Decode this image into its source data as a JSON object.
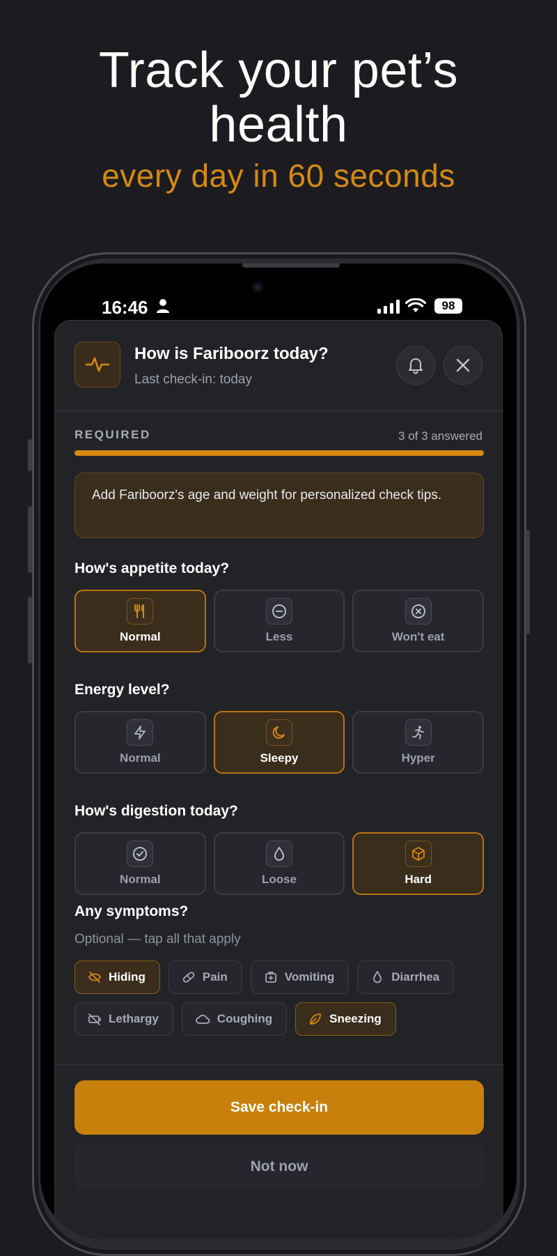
{
  "headline": {
    "line1": "Track your pet’s",
    "line2": "health",
    "accent": "every day in 60 seconds"
  },
  "status_bar": {
    "time": "16:46",
    "battery": "98"
  },
  "header": {
    "title": "How is Fariboorz today?",
    "subtitle": "Last check-in: today"
  },
  "required": {
    "label": "REQUIRED",
    "count": "3 of 3 answered",
    "progress": 1.0
  },
  "tip": "Add Fariboorz's age and weight for personalized check tips.",
  "questions": {
    "appetite": {
      "title": "How's appetite today?",
      "options": [
        {
          "label": "Normal",
          "icon": "fork-knife-icon",
          "selected": true
        },
        {
          "label": "Less",
          "icon": "minus-circle-icon",
          "selected": false
        },
        {
          "label": "Won't eat",
          "icon": "x-circle-icon",
          "selected": false
        }
      ]
    },
    "energy": {
      "title": "Energy level?",
      "options": [
        {
          "label": "Normal",
          "icon": "bolt-icon",
          "selected": false
        },
        {
          "label": "Sleepy",
          "icon": "moon-icon",
          "selected": true
        },
        {
          "label": "Hyper",
          "icon": "running-icon",
          "selected": false
        }
      ]
    },
    "digestion": {
      "title": "How's digestion today?",
      "options": [
        {
          "label": "Normal",
          "icon": "check-circle-icon",
          "selected": false
        },
        {
          "label": "Loose",
          "icon": "droplet-icon",
          "selected": false
        },
        {
          "label": "Hard",
          "icon": "cube-icon",
          "selected": true
        }
      ]
    }
  },
  "symptoms": {
    "title": "Any symptoms?",
    "subtitle": "Optional — tap all that apply",
    "chips": [
      {
        "label": "Hiding",
        "icon": "eye-off-icon",
        "selected": true
      },
      {
        "label": "Pain",
        "icon": "pill-icon",
        "selected": false
      },
      {
        "label": "Vomiting",
        "icon": "first-aid-icon",
        "selected": false
      },
      {
        "label": "Diarrhea",
        "icon": "droplet-icon",
        "selected": false
      },
      {
        "label": "Lethargy",
        "icon": "battery-off-icon",
        "selected": false
      },
      {
        "label": "Coughing",
        "icon": "cloud-icon",
        "selected": false
      },
      {
        "label": "Sneezing",
        "icon": "leaf-icon",
        "selected": true
      }
    ]
  },
  "actions": {
    "save": "Save check-in",
    "not_now": "Not now"
  },
  "colors": {
    "accent": "#d68a10",
    "button": "#c8800c",
    "background": "#1c1c20",
    "sheet": "#222327"
  }
}
